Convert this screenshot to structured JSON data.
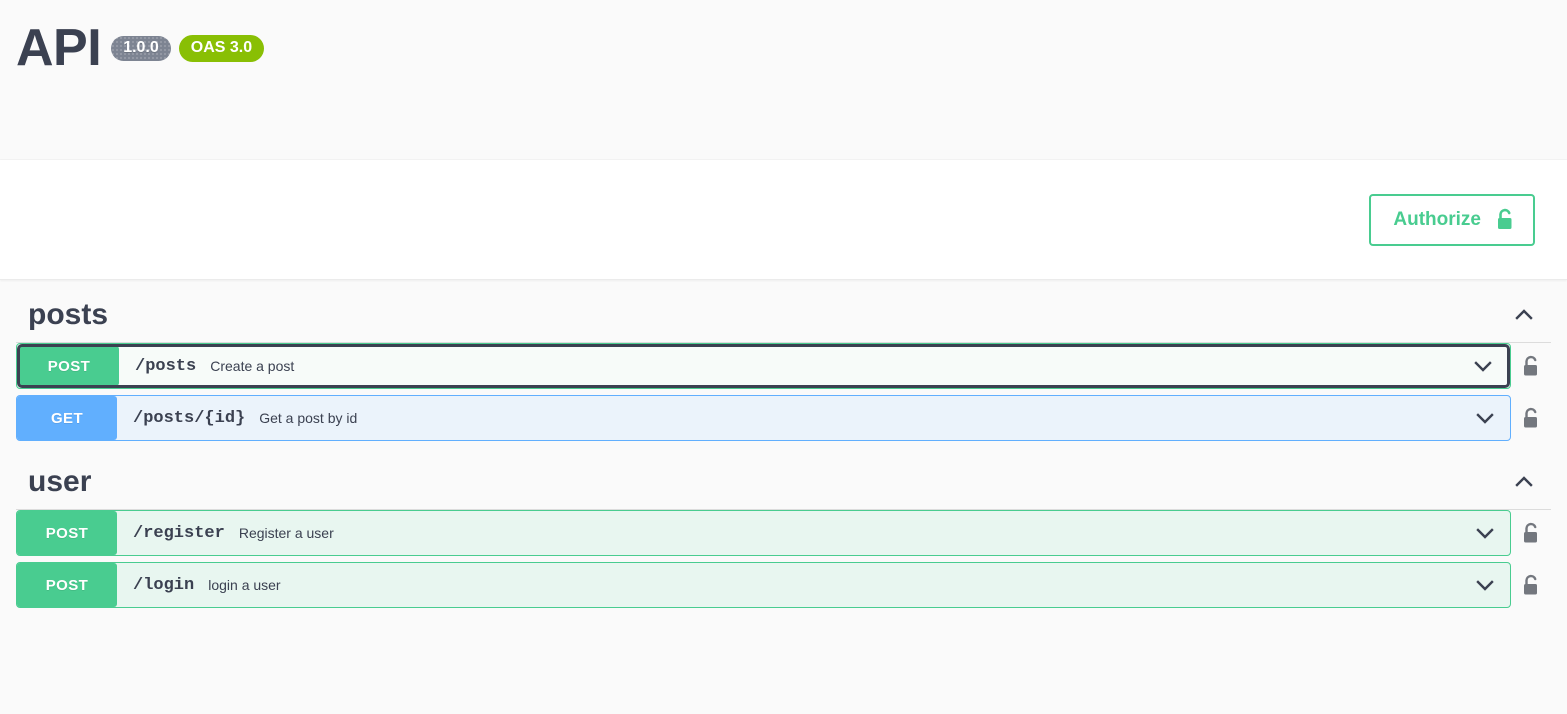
{
  "header": {
    "title": "API",
    "version_badge": "1.0.0",
    "oas_badge": "OAS 3.0"
  },
  "auth": {
    "authorize_label": "Authorize",
    "lock_icon": "unlocked-padlock-icon",
    "accent_color": "#49cc90"
  },
  "colors": {
    "post": "#49cc90",
    "get": "#61affe",
    "post_row_bg": "#e8f6f0",
    "get_row_bg": "#ebf3fb",
    "text": "#3b4151",
    "page_bg": "#fafafa",
    "oas_badge": "#89bf04",
    "version_badge": "#7d8492"
  },
  "sections": [
    {
      "title": "posts",
      "expanded": true,
      "collapse_icon": "chevron-up-icon",
      "operations": [
        {
          "method": "POST",
          "method_class": "post",
          "path": "/posts",
          "summary": "Create a post",
          "focused": true,
          "expand_icon": "chevron-down-icon",
          "lock_icon": "unlocked-padlock-icon"
        },
        {
          "method": "GET",
          "method_class": "get",
          "path": "/posts/{id}",
          "summary": "Get a post by id",
          "focused": false,
          "expand_icon": "chevron-down-icon",
          "lock_icon": "unlocked-padlock-icon"
        }
      ]
    },
    {
      "title": "user",
      "expanded": true,
      "collapse_icon": "chevron-up-icon",
      "operations": [
        {
          "method": "POST",
          "method_class": "post",
          "path": "/register",
          "summary": "Register a user",
          "focused": false,
          "expand_icon": "chevron-down-icon",
          "lock_icon": "unlocked-padlock-icon"
        },
        {
          "method": "POST",
          "method_class": "post",
          "path": "/login",
          "summary": "login a user",
          "focused": false,
          "expand_icon": "chevron-down-icon",
          "lock_icon": "unlocked-padlock-icon"
        }
      ]
    }
  ]
}
